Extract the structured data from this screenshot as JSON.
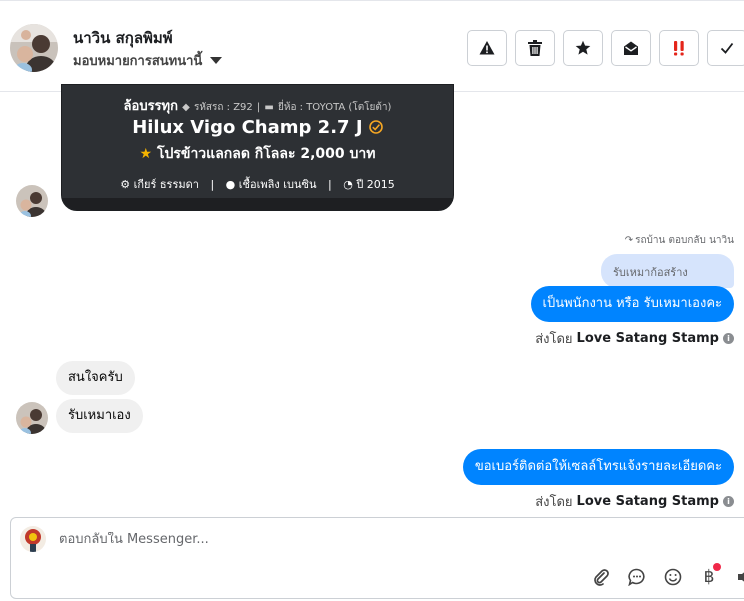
{
  "header": {
    "contact_name": "นาวิน สกุลพิมพ์",
    "assign_label": "มอบหมายการสนทนานี้",
    "actions": [
      {
        "name": "spam-button",
        "icon": "warning-icon"
      },
      {
        "name": "delete-button",
        "icon": "trash-icon"
      },
      {
        "name": "star-button",
        "icon": "star-icon"
      },
      {
        "name": "mark-unread-button",
        "icon": "envelope-open-icon"
      },
      {
        "name": "important-button",
        "icon": "exclamation-icon",
        "color": "#e4251b"
      },
      {
        "name": "done-button",
        "icon": "check-icon"
      }
    ]
  },
  "card": {
    "category": "ล้อบรรทุก",
    "code_label": "รหัสรถ : Z92",
    "brand_label": "ยี่ห้อ : TOYOTA (โตโยต้า)",
    "model": "Hilux Vigo Champ 2.7 J",
    "promo": "โปรข้าวแลกลด กิโลละ 2,000 บาท",
    "gear": "เกียร์ ธรรมดา",
    "fuel": "เชื้อเพลิง เบนซิน",
    "year": "ปี 2015",
    "promo_star_color": "#f5b400",
    "verified_color": "#f5a623"
  },
  "messages": {
    "reply_note": "รถบ้าน ตอบกลับ นาวิน",
    "quoted": "รับเหมาก้อสร้าง",
    "out_1": "เป็นพนักงาน หรือ รับเหมาเองคะ",
    "sent_by_prefix": "ส่งโดย",
    "sent_by_name": "Love Satang Stamp",
    "in_1": "สนใจครับ",
    "in_2": "รับเหมาเอง",
    "out_2": "ขอเบอร์ติดต่อให้เซลล์โทรแจ้งรายละเอียดคะ",
    "outgoing_color": "#0084ff",
    "incoming_color": "#f0f0f0"
  },
  "composer": {
    "placeholder": "ตอบกลับใน Messenger...",
    "tools": [
      "paperclip-icon",
      "speech-bubble-icon",
      "smiley-icon",
      "baht-icon",
      "sound-icon"
    ],
    "baht_glyph": "฿"
  }
}
